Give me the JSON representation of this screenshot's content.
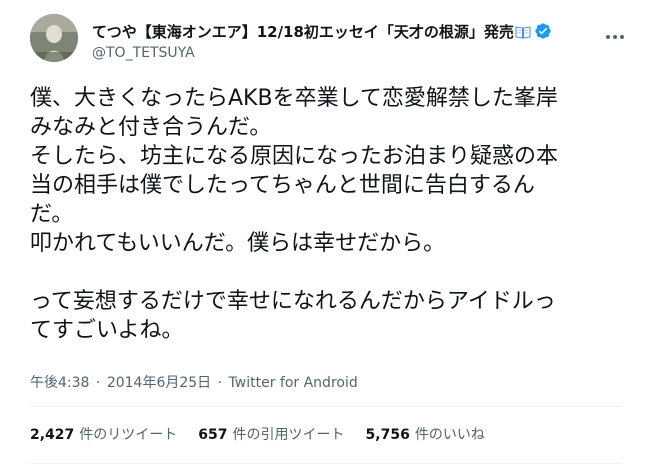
{
  "colors": {
    "text_primary": "#0f1419",
    "text_secondary": "#536471",
    "verified_blue": "#1d9bf0",
    "divider": "#eff3f4"
  },
  "author": {
    "display_name": "てつや【東海オンエア】12/18初エッセイ「天才の根源」発売",
    "handle": "@TO_TETSUYA",
    "name_emoji": "open-book-icon",
    "verified": "verified-badge-icon"
  },
  "tweet": {
    "lines": [
      "僕、大きくなったらAKBを卒業して恋愛解禁した峯岸",
      "みなみと付き合うんだ。",
      "そしたら、坊主になる原因になったお泊まり疑惑の本",
      "当の相手は僕でしたってちゃんと世間に告白するん",
      "だ。",
      "叩かれてもいいんだ。僕らは幸せだから。",
      "",
      "って妄想するだけで幸せになれるんだからアイドルっ",
      "てすごいよね。"
    ]
  },
  "meta": {
    "time": "午後4:38",
    "separator": "·",
    "date": "2014年6月25日",
    "source": "Twitter for Android"
  },
  "stats": {
    "retweets_count": "2,427",
    "retweets_label": "件のリツイート",
    "quotes_count": "657",
    "quotes_label": "件の引用ツイート",
    "likes_count": "5,756",
    "likes_label": "件のいいね"
  }
}
